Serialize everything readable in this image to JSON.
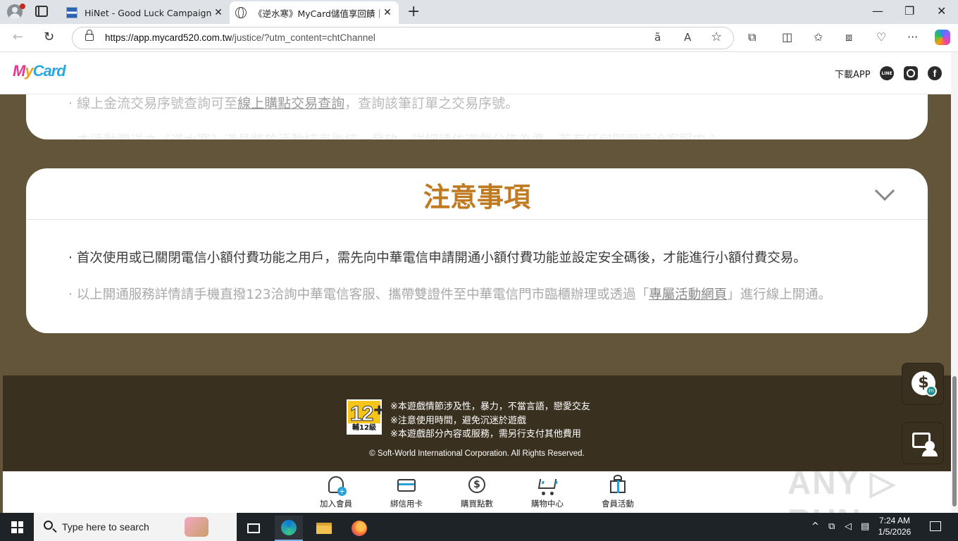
{
  "browser": {
    "tabs": [
      {
        "title": "HiNet - Good Luck Campaign",
        "active": false
      },
      {
        "title": "《逆水寒》MyCard儲值享回饋｜My",
        "active": true
      }
    ],
    "new_tab_glyph": "+",
    "close_glyph": "✕",
    "window_controls": {
      "minimize": "—",
      "restore": "❐",
      "close": "✕"
    },
    "url_host": "https://app.mycard520.com.tw",
    "url_path": "/justice/?utm_content=chtChannel"
  },
  "site": {
    "logo": {
      "m": "M",
      "y": "y",
      "c": "Card"
    },
    "header": {
      "download_label": "下載APP",
      "line_label": "LINE",
      "facebook_label": "f"
    },
    "prev_section": {
      "line1_pre": "線上金流交易序號查詢可至",
      "line1_link": "線上購點交易查詢",
      "line1_post": "，查詢該筆訂單之交易序號。",
      "line2": "‧ 本活動贈送之《逆水寒》道具將於活動結束後統一發放，詳細請依遊戲公告為準，若有任何問題請洽客服中心。"
    },
    "notes": {
      "title": "注意事項",
      "item1": "‧ 首次使用或已關閉電信小額付費功能之用戶，需先向中華電信申請開通小額付費功能並設定安全碼後，才能進行小額付費交易。",
      "item2_pre": "‧ 以上開通服務詳情請手機直撥123洽詢中華電信客服、攜帶雙證件至中華電信門市臨櫃辦理或透過「",
      "item2_link": "專屬活動網頁",
      "item2_post": "」進行線上開通。"
    },
    "footer": {
      "rating_num": "12⁺",
      "rating_label": "輔12級",
      "warnings": [
        "※本遊戲情節涉及性，暴力，不當言語，戀愛交友",
        "※注意使用時間，避免沉迷於遊戲",
        "※本遊戲部分內容或服務，需另行支付其他費用"
      ],
      "copyright": "© Soft-World International Corporation. All Rights Reserved."
    },
    "float_coin_glyph": "$",
    "bottom_nav": [
      {
        "label": "加入會員",
        "icon": "add-member-icon"
      },
      {
        "label": "綁信用卡",
        "icon": "credit-card-icon"
      },
      {
        "label": "購買點數",
        "icon": "buy-points-icon"
      },
      {
        "label": "購物中心",
        "icon": "shopping-cart-icon"
      },
      {
        "label": "會員活動",
        "icon": "gift-icon"
      }
    ]
  },
  "watermark": "ANY ▷ RUN",
  "taskbar": {
    "search_placeholder": "Type here to search",
    "time": "7:24 AM",
    "date": "1/5/2026"
  }
}
